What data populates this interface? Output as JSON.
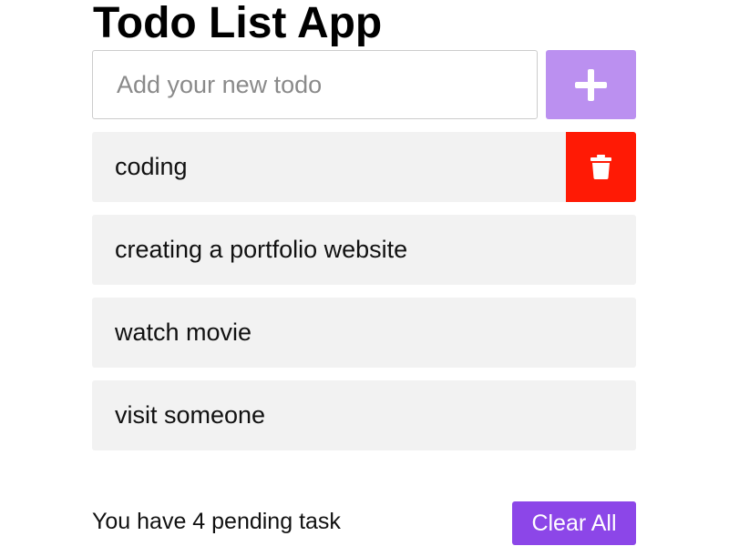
{
  "app": {
    "title": "Todo List App"
  },
  "input": {
    "placeholder": "Add your new todo",
    "value": ""
  },
  "add_button": {
    "icon": "plus-icon",
    "color": "#bb90f0"
  },
  "todos": [
    {
      "text": "coding",
      "delete_visible": true
    },
    {
      "text": "creating a portfolio website",
      "delete_visible": false
    },
    {
      "text": "watch movie",
      "delete_visible": false
    },
    {
      "text": "visit someone",
      "delete_visible": false
    }
  ],
  "delete_button": {
    "icon": "trash-icon",
    "color": "#ff1a05"
  },
  "footer": {
    "pending_text": "You have 4 pending task",
    "clear_label": "Clear All",
    "clear_color": "#8c46e8"
  }
}
